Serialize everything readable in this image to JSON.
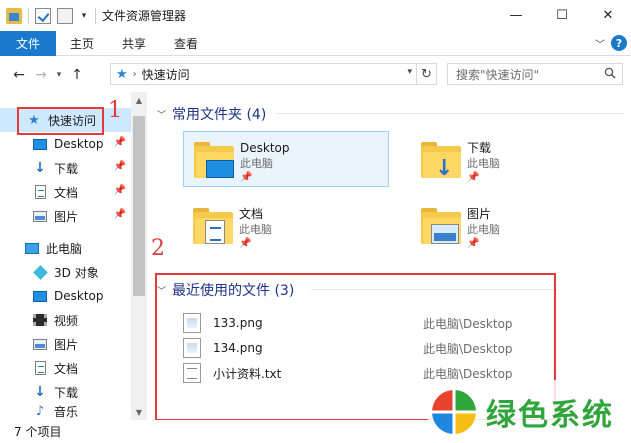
{
  "window": {
    "title": "文件资源管理器",
    "controls": {
      "minimize": "—",
      "maximize": "☐",
      "close": "✕"
    }
  },
  "ribbon": {
    "file_tab": "文件",
    "tabs": [
      "主页",
      "共享",
      "查看"
    ]
  },
  "address": {
    "path": "快速访问",
    "search_placeholder": "搜索\"快速访问\""
  },
  "navpane": {
    "items": [
      {
        "label": "快速访问",
        "icon": "star-icon",
        "selected": true
      },
      {
        "label": "Desktop",
        "icon": "desktop-icon",
        "pinned": true
      },
      {
        "label": "下载",
        "icon": "download-icon",
        "pinned": true
      },
      {
        "label": "文档",
        "icon": "document-icon",
        "pinned": true
      },
      {
        "label": "图片",
        "icon": "picture-icon",
        "pinned": true
      },
      {
        "label": "此电脑",
        "icon": "computer-icon"
      },
      {
        "label": "3D 对象",
        "icon": "3d-objects-icon"
      },
      {
        "label": "Desktop",
        "icon": "desktop-icon"
      },
      {
        "label": "视频",
        "icon": "video-icon"
      },
      {
        "label": "图片",
        "icon": "picture-icon"
      },
      {
        "label": "文档",
        "icon": "document-icon"
      },
      {
        "label": "下载",
        "icon": "download-icon"
      },
      {
        "label": "音乐",
        "icon": "music-icon"
      }
    ]
  },
  "annotations": {
    "label1": "1",
    "label2": "2"
  },
  "frequent": {
    "header": "常用文件夹 (4)",
    "folders": [
      {
        "name": "Desktop",
        "location": "此电脑",
        "overlay": "desktop"
      },
      {
        "name": "下载",
        "location": "此电脑",
        "overlay": "download"
      },
      {
        "name": "文档",
        "location": "此电脑",
        "overlay": "document"
      },
      {
        "name": "图片",
        "location": "此电脑",
        "overlay": "picture"
      }
    ]
  },
  "recent": {
    "header": "最近使用的文件 (3)",
    "files": [
      {
        "name": "133.png",
        "path": "此电脑\\Desktop",
        "type": "png"
      },
      {
        "name": "134.png",
        "path": "此电脑\\Desktop",
        "type": "png"
      },
      {
        "name": "小计资料.txt",
        "path": "此电脑\\Desktop",
        "type": "txt"
      }
    ]
  },
  "status": {
    "count": "7 个项目"
  },
  "watermark": {
    "text": "绿色系统"
  }
}
